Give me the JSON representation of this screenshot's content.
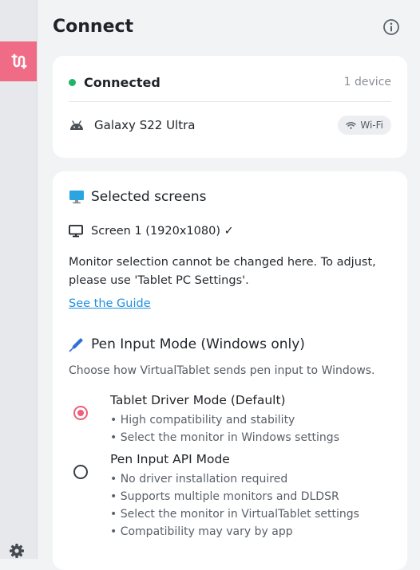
{
  "sidebar": {
    "active_item_icon": "connect-icon",
    "settings_icon": "gear-icon",
    "accent_color": "#f06b86"
  },
  "header": {
    "title": "Connect",
    "info_icon": "info-icon"
  },
  "connection": {
    "status": "Connected",
    "status_color": "#22b36a",
    "device_count": "1 device",
    "device_icon": "android-icon",
    "device_name": "Galaxy S22 Ultra",
    "connection_type": "Wi-Fi"
  },
  "screens": {
    "title": "Selected screens",
    "screen_label": "Screen 1 (1920x1080) ✓",
    "notice": "Monitor selection cannot be changed here. To adjust, please use 'Tablet PC Settings'.",
    "guide_link": "See the Guide"
  },
  "pen_input": {
    "title": "Pen Input Mode (Windows only)",
    "description": "Choose how VirtualTablet sends pen input to Windows.",
    "options": [
      {
        "title": "Tablet Driver Mode (Default)",
        "selected": true,
        "bullets": [
          "• High compatibility and stability",
          "• Select the monitor in Windows settings"
        ]
      },
      {
        "title": "Pen Input API Mode",
        "selected": false,
        "bullets": [
          "• No driver installation required",
          "• Supports multiple monitors and DLDSR",
          "• Select the monitor in VirtualTablet settings",
          "• Compatibility may vary by app"
        ]
      }
    ]
  }
}
